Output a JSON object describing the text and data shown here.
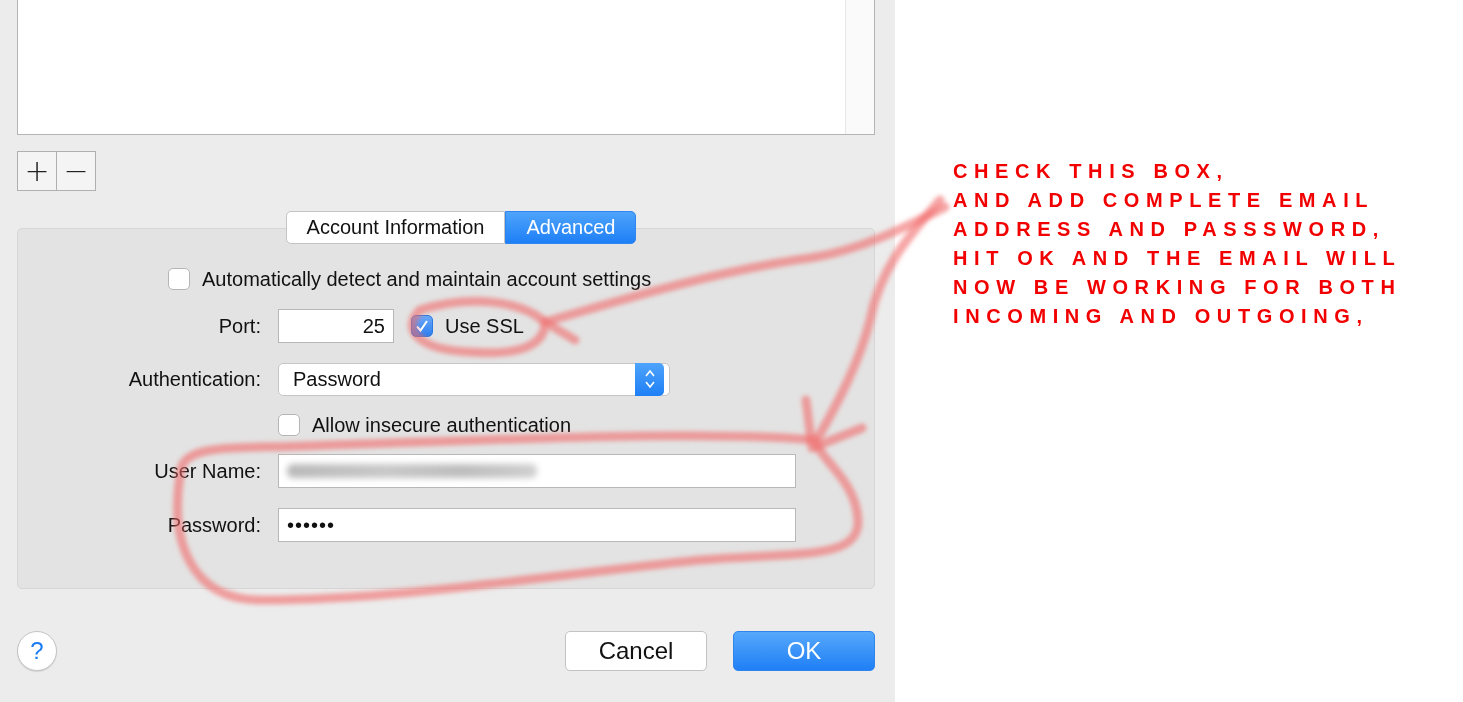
{
  "list_buttons": [
    "+",
    "−"
  ],
  "tabs": [
    {
      "label": "Account Information",
      "selected": false
    },
    {
      "label": "Advanced",
      "selected": true
    }
  ],
  "auto_detect": {
    "label": "Automatically detect and maintain account settings",
    "checked": false
  },
  "port": {
    "label": "Port:",
    "value": "25"
  },
  "use_ssl": {
    "label": "Use SSL",
    "checked": true
  },
  "authentication": {
    "label": "Authentication:",
    "value": "Password"
  },
  "allow_insecure": {
    "label": "Allow insecure authentication",
    "checked": false
  },
  "user_name": {
    "label": "User Name:",
    "blurred": true
  },
  "password": {
    "label": "Password:",
    "value": "••••••"
  },
  "help_button": "?",
  "buttons": [
    {
      "label": "Cancel",
      "kind": "cancel"
    },
    {
      "label": "OK",
      "kind": "default"
    }
  ],
  "annotation": {
    "lines": [
      "CHECK THIS BOX,",
      "AND ADD COMPLETE EMAIL",
      "ADDRESS AND PASSSWORD,",
      "HIT OK AND THE EMAIL WILL",
      "NOW BE WORKING FOR BOTH",
      "INCOMING AND OUTGOING,"
    ]
  }
}
